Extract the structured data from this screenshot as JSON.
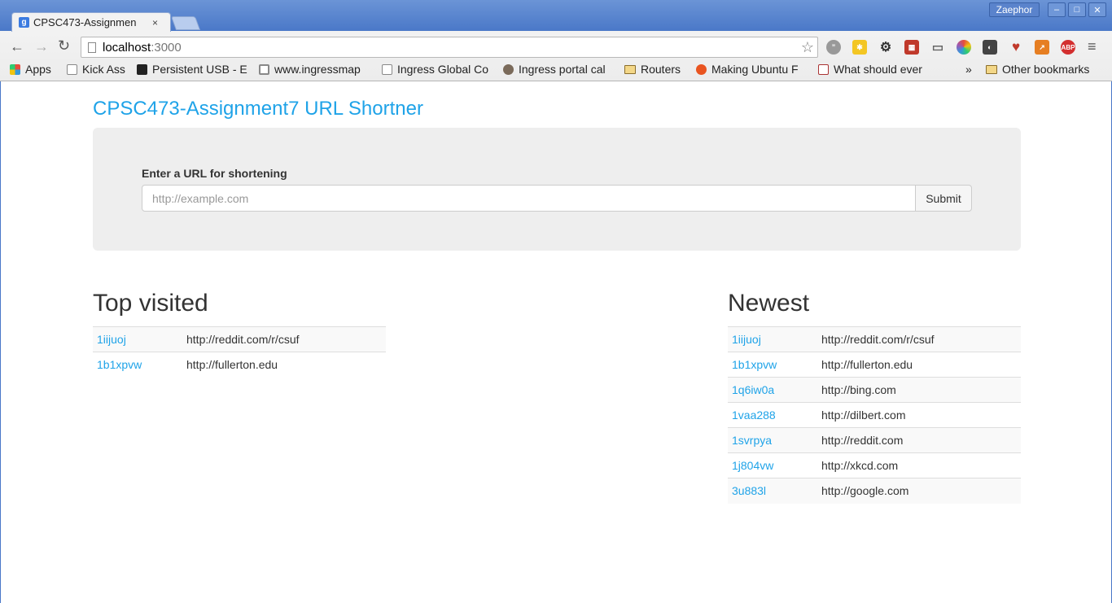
{
  "browser": {
    "tab_title": "CPSC473-Assignmen",
    "tab_close": "×",
    "profile_name": "Zaephor",
    "url_host": "localhost",
    "url_port": ":3000",
    "bookmarks": [
      {
        "label": "Apps",
        "icon": "apps-grid-icon"
      },
      {
        "label": "Kick Ass",
        "icon": "page-icon"
      },
      {
        "label": "Persistent USB - E",
        "icon": "terminal-icon"
      },
      {
        "label": "www.ingressmap",
        "icon": "square-icon"
      },
      {
        "label": "Ingress Global Co",
        "icon": "page-icon"
      },
      {
        "label": "Ingress portal cal",
        "icon": "bird-icon"
      },
      {
        "label": "Routers",
        "icon": "folder-icon"
      },
      {
        "label": "Making Ubuntu F",
        "icon": "ubuntu-icon"
      },
      {
        "label": "What should ever",
        "icon": "bookmark-icon"
      }
    ],
    "overflow": "»",
    "other_bookmarks": "Other bookmarks"
  },
  "page": {
    "app_title": "CPSC473-Assignment7 URL Shortner",
    "form": {
      "label": "Enter a URL for shortening",
      "placeholder": "http://example.com",
      "submit_label": "Submit"
    },
    "top_visited": {
      "title": "Top visited",
      "rows": [
        {
          "code": "1iijuoj",
          "url": "http://reddit.com/r/csuf"
        },
        {
          "code": "1b1xpvw",
          "url": "http://fullerton.edu"
        }
      ]
    },
    "newest": {
      "title": "Newest",
      "rows": [
        {
          "code": "1iijuoj",
          "url": "http://reddit.com/r/csuf"
        },
        {
          "code": "1b1xpvw",
          "url": "http://fullerton.edu"
        },
        {
          "code": "1q6iw0a",
          "url": "http://bing.com"
        },
        {
          "code": "1vaa288",
          "url": "http://dilbert.com"
        },
        {
          "code": "1svrpya",
          "url": "http://reddit.com"
        },
        {
          "code": "1j804vw",
          "url": "http://xkcd.com"
        },
        {
          "code": "3u883l",
          "url": "http://google.com"
        }
      ]
    }
  }
}
